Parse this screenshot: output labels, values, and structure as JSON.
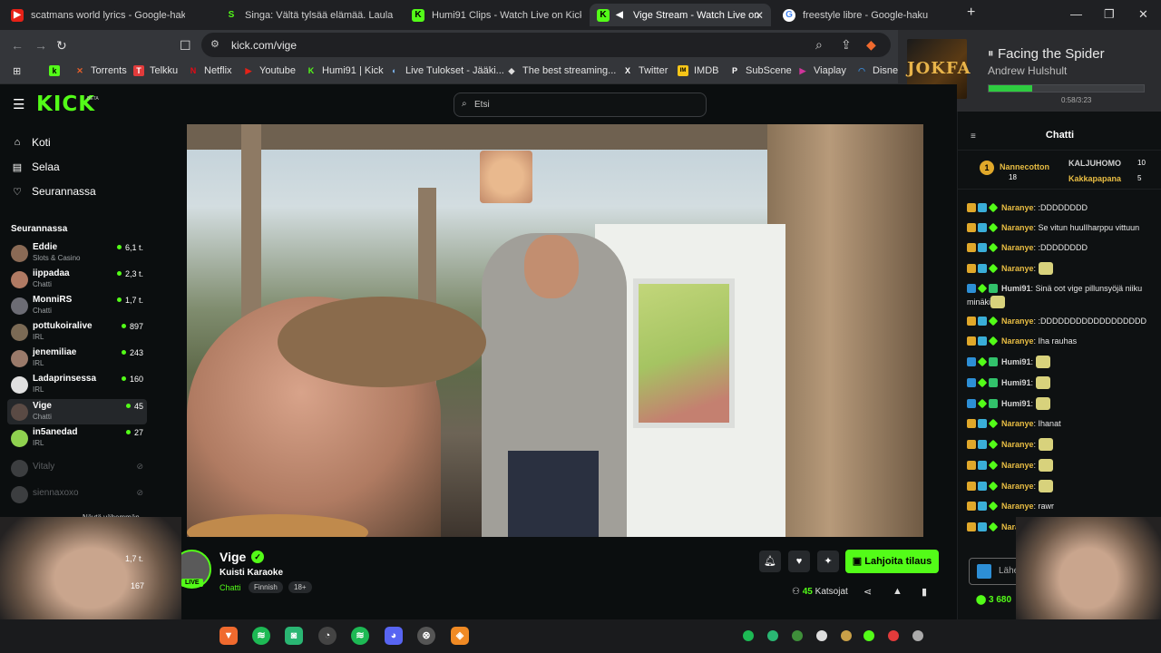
{
  "browser": {
    "tabs": [
      {
        "label": "scatmans world lyrics - Google-haku",
        "favicon": "youtube-icon"
      },
      {
        "label": "Singa: Vältä tylsää elämää. Laula kara",
        "favicon": "singa-icon"
      },
      {
        "label": "Humi91 Clips - Watch Live on Kick",
        "favicon": "kick-icon"
      },
      {
        "label": "Vige Stream - Watch Live on",
        "favicon": "kick-icon"
      },
      {
        "label": "freestyle libre - Google-haku",
        "favicon": "google-icon"
      }
    ],
    "url": "kick.com/vige",
    "bookmarks": [
      "Torrents",
      "Telkku",
      "Netflix",
      "Youtube",
      "Humi91 | Kick",
      "Live Tulokset - Jääki...",
      "The best streaming...",
      "Twitter",
      "IMDB",
      "SubScene",
      "Viaplay",
      "Disne"
    ]
  },
  "media": {
    "album_text": "JOKFA",
    "title": "Facing the Spider",
    "artist": "Andrew Hulshult",
    "progress": 0.28,
    "time": "0:58/3:23"
  },
  "kick": {
    "logo": "KICK",
    "beta": "BETA",
    "search_placeholder": "Etsi"
  },
  "sidebar": {
    "nav": [
      "Koti",
      "Selaa",
      "Seurannassa"
    ],
    "following_title": "Seurannassa",
    "channels": [
      {
        "name": "Eddie",
        "category": "Slots & Casino",
        "viewers": "6,1 t."
      },
      {
        "name": "iippadaa",
        "category": "Chatti",
        "viewers": "2,3 t."
      },
      {
        "name": "MonniRS",
        "category": "Chatti",
        "viewers": "1,7 t."
      },
      {
        "name": "pottukoiralive",
        "category": "IRL",
        "viewers": "897"
      },
      {
        "name": "jenemiliae",
        "category": "IRL",
        "viewers": "243"
      },
      {
        "name": "Ladaprinsessa",
        "category": "IRL",
        "viewers": "160"
      },
      {
        "name": "Vige",
        "category": "Chatti",
        "viewers": "45"
      },
      {
        "name": "in5anedad",
        "category": "IRL",
        "viewers": "27"
      },
      {
        "name": "Vitaly",
        "category": "",
        "viewers": ""
      },
      {
        "name": "siennaxoxo",
        "category": "",
        "viewers": ""
      }
    ],
    "show_less": "Näytä vähemmän",
    "extra_counts": [
      "1,7 t.",
      "167"
    ]
  },
  "stream": {
    "name": "Vige",
    "title": "Kuisti Karaoke",
    "category": "Chatti",
    "tags": [
      "Finnish",
      "18+"
    ],
    "live": "LIVE",
    "gift_label": "Lahjoita tilaus",
    "viewer_count": "45",
    "viewer_label": "Katsojat"
  },
  "chat": {
    "title": "Chatti",
    "leaders": [
      {
        "name": "Nannecotton",
        "count": "18"
      },
      {
        "name": "KALJUHOMO",
        "count": "10"
      },
      {
        "name": "Kakkapapana",
        "count": "5"
      }
    ],
    "messages": [
      {
        "user": "Naranye",
        "text": ":DDDDDDDD",
        "emote": false
      },
      {
        "user": "Naranye",
        "text": "Se vitun huulIharppu vittuun",
        "emote": false
      },
      {
        "user": "Naranye",
        "text": ":DDDDDDDD",
        "emote": false
      },
      {
        "user": "Naranye",
        "text": "",
        "emote": true
      },
      {
        "user": "Humi91",
        "text": "Sinä oot vige pillunsyöjä niiku minäki",
        "emote": true
      },
      {
        "user": "Naranye",
        "text": ":DDDDDDDDDDDDDDDDDD",
        "emote": false
      },
      {
        "user": "Naranye",
        "text": "Iha rauhas",
        "emote": false
      },
      {
        "user": "Humi91",
        "text": "",
        "emote": true
      },
      {
        "user": "Humi91",
        "text": "",
        "emote": true
      },
      {
        "user": "Humi91",
        "text": "",
        "emote": true
      },
      {
        "user": "Naranye",
        "text": "Ihanat",
        "emote": false
      },
      {
        "user": "Naranye",
        "text": "",
        "emote": true
      },
      {
        "user": "Naranye",
        "text": "",
        "emote": true
      },
      {
        "user": "Naranye",
        "text": "",
        "emote": true
      },
      {
        "user": "Naranye",
        "text": "rawr",
        "emote": false
      },
      {
        "user": "Naranye",
        "text": "",
        "emote": true
      }
    ],
    "input_placeholder": "Lähetä v",
    "points": "3 680"
  }
}
